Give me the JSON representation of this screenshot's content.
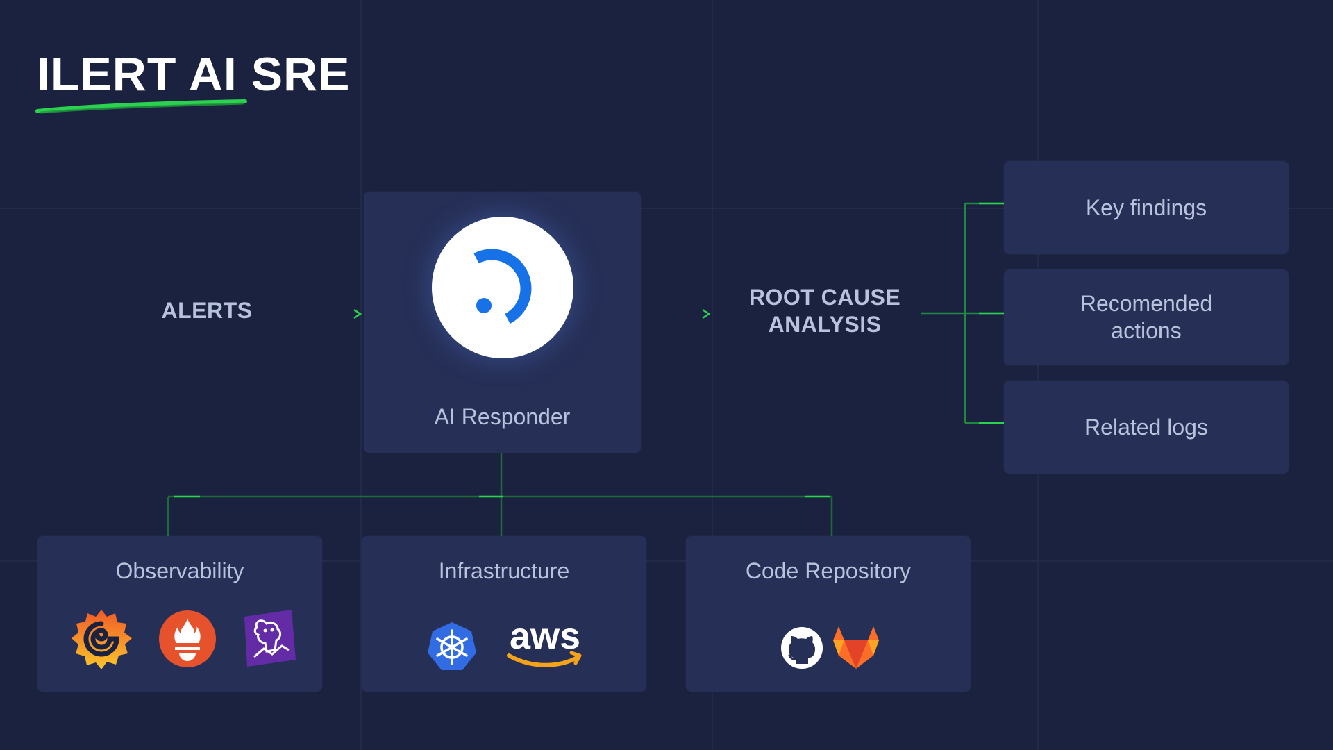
{
  "header": {
    "title": "ILERT AI SRE"
  },
  "input": {
    "label": "ALERTS"
  },
  "responder": {
    "label": "AI Responder",
    "logo_icon": "ilert-logo-icon"
  },
  "output": {
    "label_line1": "ROOT CAUSE",
    "label_line2": "ANALYSIS"
  },
  "results": {
    "items": [
      {
        "line1": "Key findings",
        "line2": ""
      },
      {
        "line1": "Recomended",
        "line2": "actions"
      },
      {
        "line1": "Related logs",
        "line2": ""
      }
    ]
  },
  "sources": [
    {
      "title": "Observability",
      "icons": [
        "grafana-icon",
        "prometheus-icon",
        "datadog-icon"
      ]
    },
    {
      "title": "Infrastructure",
      "icons": [
        "kubernetes-icon",
        "aws-icon"
      ]
    },
    {
      "title": "Code Repository",
      "icons": [
        "github-icon",
        "gitlab-icon"
      ]
    }
  ],
  "aws_logo_text": "aws",
  "colors": {
    "background": "#1b2240",
    "card": "#262f56",
    "accent_green": "#2bd14f",
    "brand_blue": "#1672e6"
  }
}
